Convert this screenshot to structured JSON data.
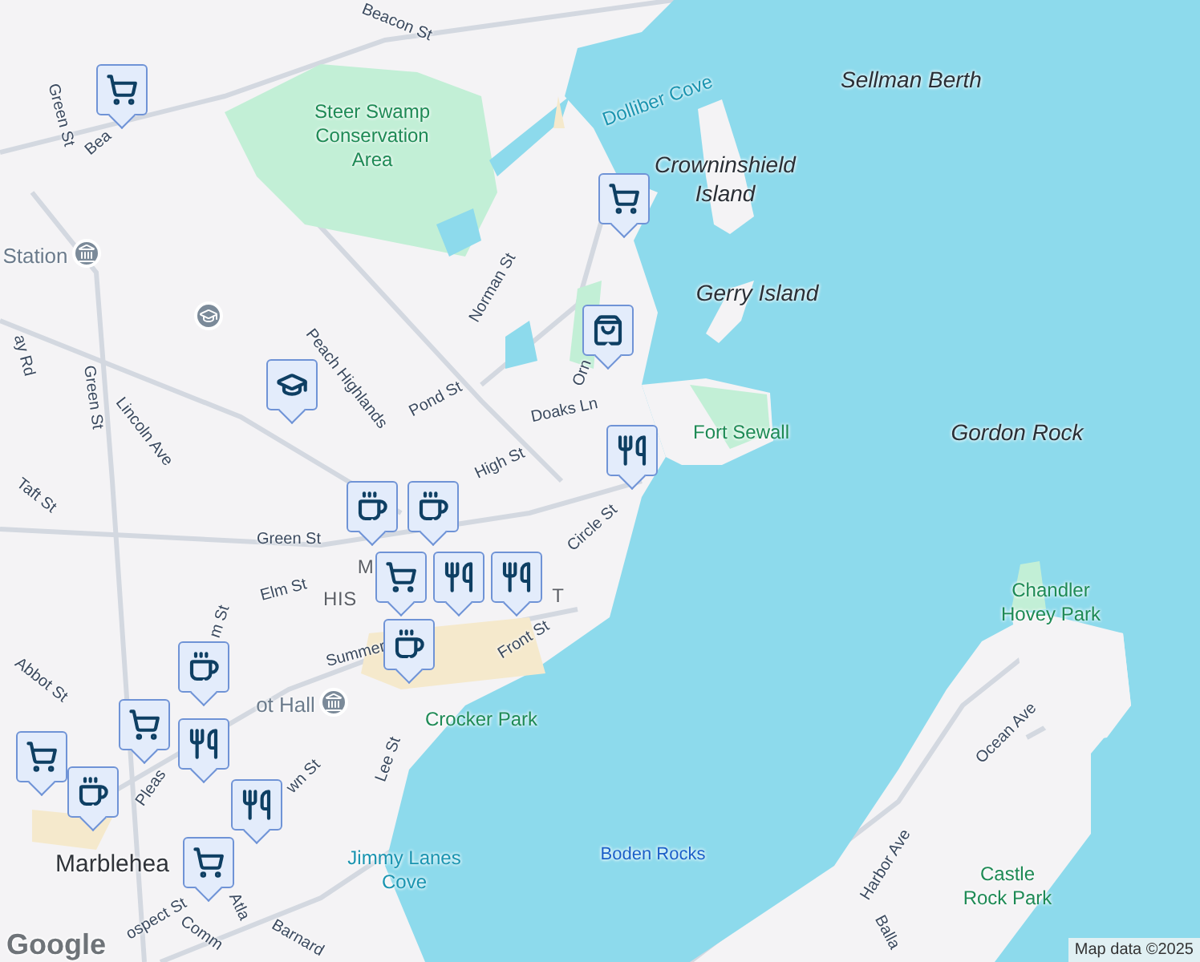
{
  "labels": [
    {
      "text": "Beacon St",
      "kind": "street"
    },
    {
      "text": "Sellman Berth",
      "kind": "island"
    },
    {
      "text": "Dolliber Cove",
      "kind": "water"
    },
    {
      "text": "Green St",
      "kind": "street"
    },
    {
      "text": "Bea",
      "kind": "street"
    },
    {
      "text": "Steer Swamp Conservation Area",
      "kind": "park"
    },
    {
      "text": "Crowninshield Island",
      "kind": "island"
    },
    {
      "text": "Station",
      "kind": "poi"
    },
    {
      "text": "Gerry Island",
      "kind": "island"
    },
    {
      "text": "Norman St",
      "kind": "street"
    },
    {
      "text": "ay Rd",
      "kind": "street"
    },
    {
      "text": "Orn",
      "kind": "street"
    },
    {
      "text": "Peach Highlands",
      "kind": "street"
    },
    {
      "text": "Green St",
      "kind": "street"
    },
    {
      "text": "Pond St",
      "kind": "street"
    },
    {
      "text": "Lincoln Ave",
      "kind": "street"
    },
    {
      "text": "Doaks Ln",
      "kind": "street"
    },
    {
      "text": "Fort Sewall",
      "kind": "park"
    },
    {
      "text": "Gordon Rock",
      "kind": "island"
    },
    {
      "text": "High St",
      "kind": "street"
    },
    {
      "text": "Taft St",
      "kind": "street"
    },
    {
      "text": "Green St",
      "kind": "street"
    },
    {
      "text": "Circle St",
      "kind": "street"
    },
    {
      "text": "M",
      "kind": "district"
    },
    {
      "text": "Elm St",
      "kind": "street"
    },
    {
      "text": "HIS",
      "kind": "district"
    },
    {
      "text": "T",
      "kind": "district"
    },
    {
      "text": "Chandler Hovey Park",
      "kind": "park"
    },
    {
      "text": "m St",
      "kind": "street"
    },
    {
      "text": "Summer",
      "kind": "street"
    },
    {
      "text": "Front St",
      "kind": "street"
    },
    {
      "text": "Abbot St",
      "kind": "street"
    },
    {
      "text": "ot Hall",
      "kind": "poi"
    },
    {
      "text": "Crocker Park",
      "kind": "park"
    },
    {
      "text": "Ocean Ave",
      "kind": "street"
    },
    {
      "text": "Lee St",
      "kind": "street"
    },
    {
      "text": "wn St",
      "kind": "street"
    },
    {
      "text": "Pleas",
      "kind": "street"
    },
    {
      "text": "Boden Rocks",
      "kind": "rocks"
    },
    {
      "text": "Harbor Ave",
      "kind": "street"
    },
    {
      "text": "Marblehea",
      "kind": "town"
    },
    {
      "text": "Jimmy Lanes Cove",
      "kind": "water"
    },
    {
      "text": "Castle Rock Park",
      "kind": "park"
    },
    {
      "text": "Atla",
      "kind": "street"
    },
    {
      "text": "ospect St",
      "kind": "street"
    },
    {
      "text": "Barnard",
      "kind": "street"
    },
    {
      "text": "Comm",
      "kind": "street"
    },
    {
      "text": "Balla",
      "kind": "street"
    }
  ],
  "pois": [
    {
      "kind": "museum"
    },
    {
      "kind": "school"
    },
    {
      "kind": "museum"
    }
  ],
  "markers": [
    {
      "kind": "grocery"
    },
    {
      "kind": "grocery"
    },
    {
      "kind": "shopping"
    },
    {
      "kind": "school"
    },
    {
      "kind": "restaurant"
    },
    {
      "kind": "cafe"
    },
    {
      "kind": "cafe"
    },
    {
      "kind": "grocery"
    },
    {
      "kind": "restaurant"
    },
    {
      "kind": "restaurant"
    },
    {
      "kind": "cafe"
    },
    {
      "kind": "cafe"
    },
    {
      "kind": "grocery"
    },
    {
      "kind": "grocery"
    },
    {
      "kind": "cafe"
    },
    {
      "kind": "restaurant"
    },
    {
      "kind": "restaurant"
    },
    {
      "kind": "grocery"
    }
  ],
  "logo": "Google",
  "attribution": "Map data ©2025"
}
